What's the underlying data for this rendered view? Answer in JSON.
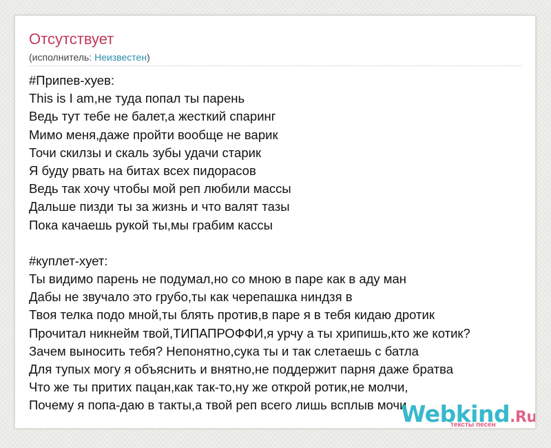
{
  "song": {
    "title": "Отсутствует",
    "artist_prefix": "(исполнитель: ",
    "artist_name": "Неизвестен",
    "artist_suffix": ")"
  },
  "lyrics": [
    "#Припев-хуев:",
    "This is I am,не туда попал ты парень",
    "Ведь тут тебе не балет,а жесткий спаринг",
    "Мимо меня,даже пройти вообще не варик",
    "Точи скилзы и скаль зубы удачи старик",
    "Я буду рвать на битах всех пидорасов",
    "Ведь так хочу чтобы мой реп любили массы",
    "Дальше пизди ты за жизнь и что валят тазы",
    "Пока качаешь рукой ты,мы грабим кассы",
    "",
    "#куплет-хует:",
    "Ты видимо парень не подумал,но со мною в паре как в аду ман",
    "Дабы не звучало это грубо,ты как черепашка ниндзя в",
    "Твоя телка подо мной,ты блять против,в паре я в тебя кидаю дротик",
    "Прочитал никнейм твой,ТИПАПРОФФИ,я урчу а ты хрипишь,кто же котик?",
    "Зачем выносить тебя? Непонятно,сука ты и так слетаешь с батла",
    "Для тупых могу я объяснить и внятно,не поддержит парня даже братва",
    "Что же ты притих пацан,как так-то,ну же открой ротик,не молчи,",
    "Почему я попа-даю в такты,а твой реп всего лишь всплыв мочи"
  ],
  "watermark": {
    "logo": "Webkind",
    "logo_suffix": ".Ru",
    "tagline": "тексты песен"
  },
  "colors": {
    "title": "#c03a5c",
    "artist_link": "#2a8fa8",
    "logo": "#27b3c9",
    "logo_accent": "#e0567c"
  }
}
